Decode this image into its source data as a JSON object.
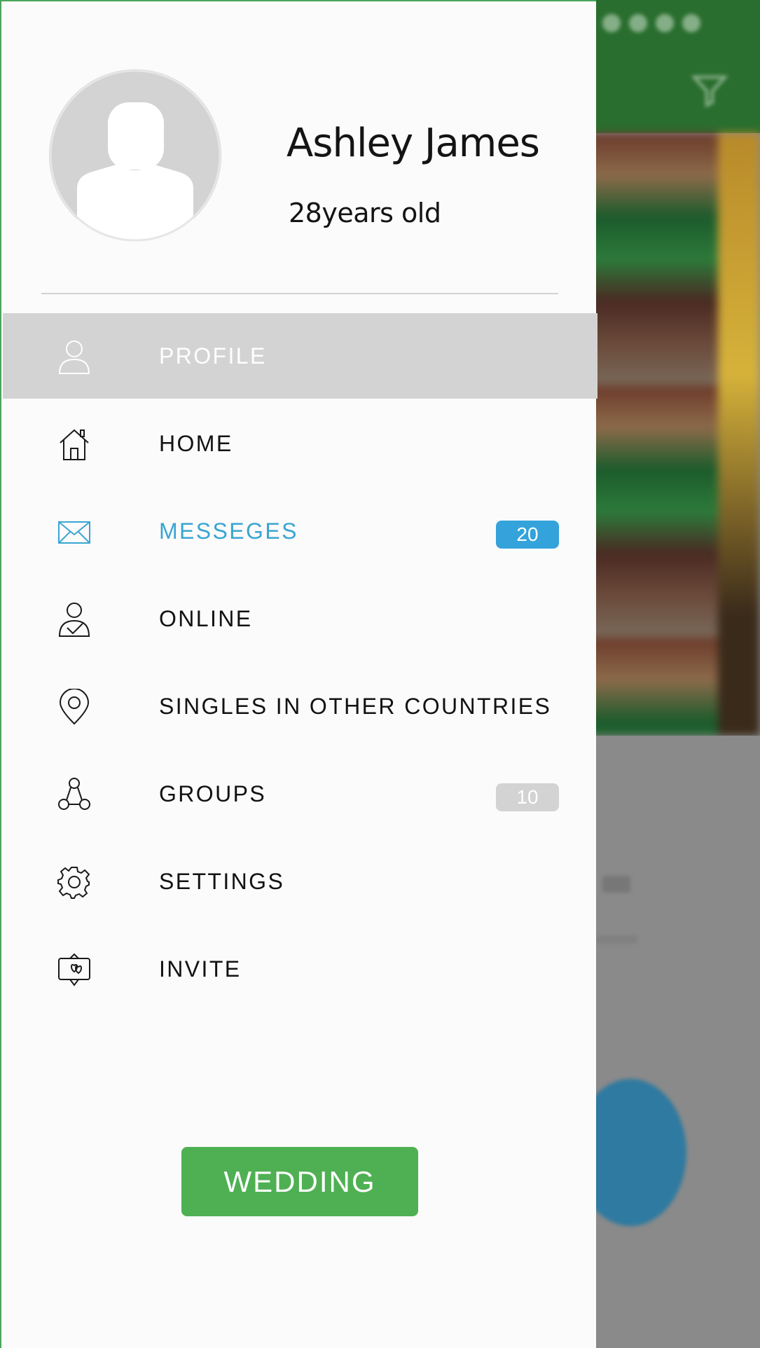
{
  "user": {
    "name": "Ashley James",
    "age": "28years old"
  },
  "menu": {
    "items": [
      {
        "label": "PROFILE",
        "icon": "user-icon",
        "state": "selected"
      },
      {
        "label": "HOME",
        "icon": "home-icon"
      },
      {
        "label": "MESSEGES",
        "icon": "envelope-icon",
        "badge": "20",
        "accent": true
      },
      {
        "label": "ONLINE",
        "icon": "user-check-icon"
      },
      {
        "label": "SINGLES IN  OTHER COUNTRIES",
        "icon": "location-pin-icon"
      },
      {
        "label": "GROUPS",
        "icon": "groups-icon",
        "badge": "10"
      },
      {
        "label": "SETTINGS",
        "icon": "gear-icon"
      },
      {
        "label": "INVITE",
        "icon": "invite-card-icon"
      }
    ]
  },
  "actions": {
    "wedding_label": "WEDDING"
  },
  "colors": {
    "selected_item_bg": "#d3d3d3",
    "accent_text": "#3aa5d2",
    "badge_blue": "#35a3db",
    "badge_grey": "#d3d3d3",
    "wedding_button": "#4fb053",
    "background_app_bar": "#2a6e2f"
  }
}
